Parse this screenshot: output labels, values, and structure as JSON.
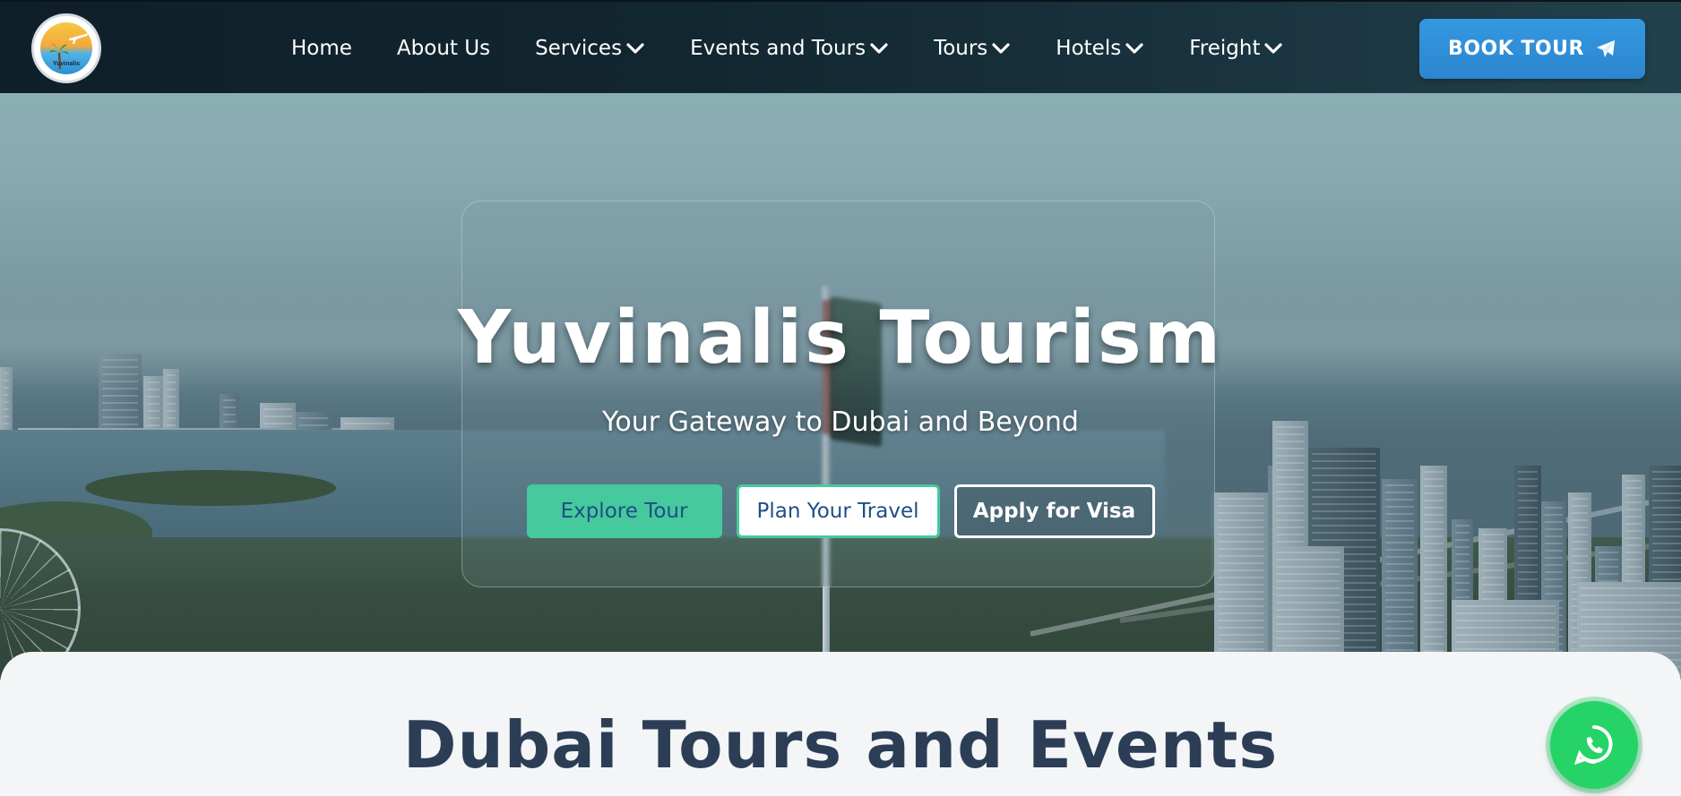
{
  "brand": {
    "logo_text": "Yuvinalis",
    "logo_icon": "palm-sun-plane-logo"
  },
  "nav": {
    "items": [
      {
        "label": "Home",
        "dropdown": false
      },
      {
        "label": "About Us",
        "dropdown": false
      },
      {
        "label": "Services",
        "dropdown": true
      },
      {
        "label": "Events and Tours",
        "dropdown": true
      },
      {
        "label": "Tours",
        "dropdown": true
      },
      {
        "label": "Hotels",
        "dropdown": true
      },
      {
        "label": "Freight",
        "dropdown": true
      }
    ],
    "cta_label": "BOOK TOUR",
    "cta_icon": "paper-plane-icon"
  },
  "hero": {
    "title": "Yuvinalis Tourism",
    "subtitle": "Your Gateway to Dubai and Beyond",
    "buttons": {
      "explore": "Explore Tour",
      "plan": "Plan Your Travel",
      "visa": "Apply for Visa"
    }
  },
  "section": {
    "title": "Dubai Tours and Events"
  },
  "floating": {
    "whatsapp_icon": "whatsapp-icon"
  },
  "colors": {
    "nav_bg": "#12262f",
    "cta_blue": "#3498e0",
    "accent_green": "#46c99c",
    "link_blue": "#1d4f86",
    "heading_navy": "#2c3e55",
    "whatsapp_green": "#25d366"
  }
}
